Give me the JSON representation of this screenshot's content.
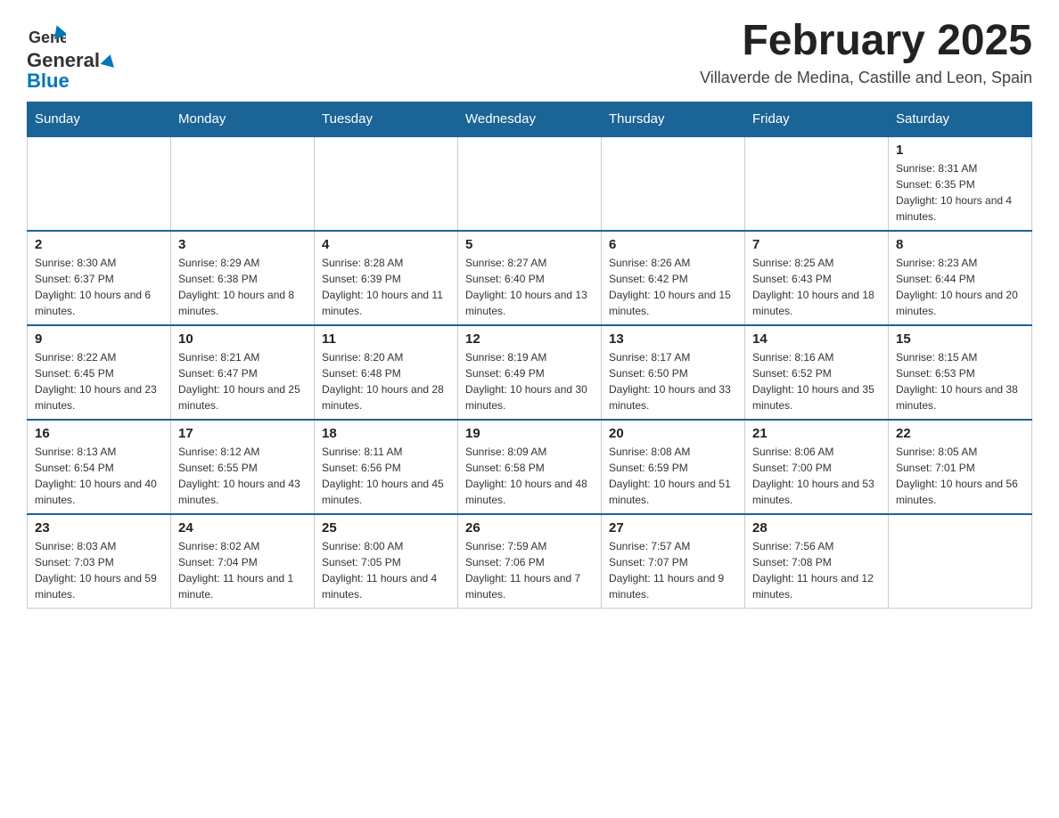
{
  "header": {
    "logo_general": "General",
    "logo_blue": "Blue",
    "title": "February 2025",
    "subtitle": "Villaverde de Medina, Castille and Leon, Spain"
  },
  "days_of_week": [
    "Sunday",
    "Monday",
    "Tuesday",
    "Wednesday",
    "Thursday",
    "Friday",
    "Saturday"
  ],
  "weeks": [
    [
      {
        "day": "",
        "info": ""
      },
      {
        "day": "",
        "info": ""
      },
      {
        "day": "",
        "info": ""
      },
      {
        "day": "",
        "info": ""
      },
      {
        "day": "",
        "info": ""
      },
      {
        "day": "",
        "info": ""
      },
      {
        "day": "1",
        "info": "Sunrise: 8:31 AM\nSunset: 6:35 PM\nDaylight: 10 hours and 4 minutes."
      }
    ],
    [
      {
        "day": "2",
        "info": "Sunrise: 8:30 AM\nSunset: 6:37 PM\nDaylight: 10 hours and 6 minutes."
      },
      {
        "day": "3",
        "info": "Sunrise: 8:29 AM\nSunset: 6:38 PM\nDaylight: 10 hours and 8 minutes."
      },
      {
        "day": "4",
        "info": "Sunrise: 8:28 AM\nSunset: 6:39 PM\nDaylight: 10 hours and 11 minutes."
      },
      {
        "day": "5",
        "info": "Sunrise: 8:27 AM\nSunset: 6:40 PM\nDaylight: 10 hours and 13 minutes."
      },
      {
        "day": "6",
        "info": "Sunrise: 8:26 AM\nSunset: 6:42 PM\nDaylight: 10 hours and 15 minutes."
      },
      {
        "day": "7",
        "info": "Sunrise: 8:25 AM\nSunset: 6:43 PM\nDaylight: 10 hours and 18 minutes."
      },
      {
        "day": "8",
        "info": "Sunrise: 8:23 AM\nSunset: 6:44 PM\nDaylight: 10 hours and 20 minutes."
      }
    ],
    [
      {
        "day": "9",
        "info": "Sunrise: 8:22 AM\nSunset: 6:45 PM\nDaylight: 10 hours and 23 minutes."
      },
      {
        "day": "10",
        "info": "Sunrise: 8:21 AM\nSunset: 6:47 PM\nDaylight: 10 hours and 25 minutes."
      },
      {
        "day": "11",
        "info": "Sunrise: 8:20 AM\nSunset: 6:48 PM\nDaylight: 10 hours and 28 minutes."
      },
      {
        "day": "12",
        "info": "Sunrise: 8:19 AM\nSunset: 6:49 PM\nDaylight: 10 hours and 30 minutes."
      },
      {
        "day": "13",
        "info": "Sunrise: 8:17 AM\nSunset: 6:50 PM\nDaylight: 10 hours and 33 minutes."
      },
      {
        "day": "14",
        "info": "Sunrise: 8:16 AM\nSunset: 6:52 PM\nDaylight: 10 hours and 35 minutes."
      },
      {
        "day": "15",
        "info": "Sunrise: 8:15 AM\nSunset: 6:53 PM\nDaylight: 10 hours and 38 minutes."
      }
    ],
    [
      {
        "day": "16",
        "info": "Sunrise: 8:13 AM\nSunset: 6:54 PM\nDaylight: 10 hours and 40 minutes."
      },
      {
        "day": "17",
        "info": "Sunrise: 8:12 AM\nSunset: 6:55 PM\nDaylight: 10 hours and 43 minutes."
      },
      {
        "day": "18",
        "info": "Sunrise: 8:11 AM\nSunset: 6:56 PM\nDaylight: 10 hours and 45 minutes."
      },
      {
        "day": "19",
        "info": "Sunrise: 8:09 AM\nSunset: 6:58 PM\nDaylight: 10 hours and 48 minutes."
      },
      {
        "day": "20",
        "info": "Sunrise: 8:08 AM\nSunset: 6:59 PM\nDaylight: 10 hours and 51 minutes."
      },
      {
        "day": "21",
        "info": "Sunrise: 8:06 AM\nSunset: 7:00 PM\nDaylight: 10 hours and 53 minutes."
      },
      {
        "day": "22",
        "info": "Sunrise: 8:05 AM\nSunset: 7:01 PM\nDaylight: 10 hours and 56 minutes."
      }
    ],
    [
      {
        "day": "23",
        "info": "Sunrise: 8:03 AM\nSunset: 7:03 PM\nDaylight: 10 hours and 59 minutes."
      },
      {
        "day": "24",
        "info": "Sunrise: 8:02 AM\nSunset: 7:04 PM\nDaylight: 11 hours and 1 minute."
      },
      {
        "day": "25",
        "info": "Sunrise: 8:00 AM\nSunset: 7:05 PM\nDaylight: 11 hours and 4 minutes."
      },
      {
        "day": "26",
        "info": "Sunrise: 7:59 AM\nSunset: 7:06 PM\nDaylight: 11 hours and 7 minutes."
      },
      {
        "day": "27",
        "info": "Sunrise: 7:57 AM\nSunset: 7:07 PM\nDaylight: 11 hours and 9 minutes."
      },
      {
        "day": "28",
        "info": "Sunrise: 7:56 AM\nSunset: 7:08 PM\nDaylight: 11 hours and 12 minutes."
      },
      {
        "day": "",
        "info": ""
      }
    ]
  ]
}
